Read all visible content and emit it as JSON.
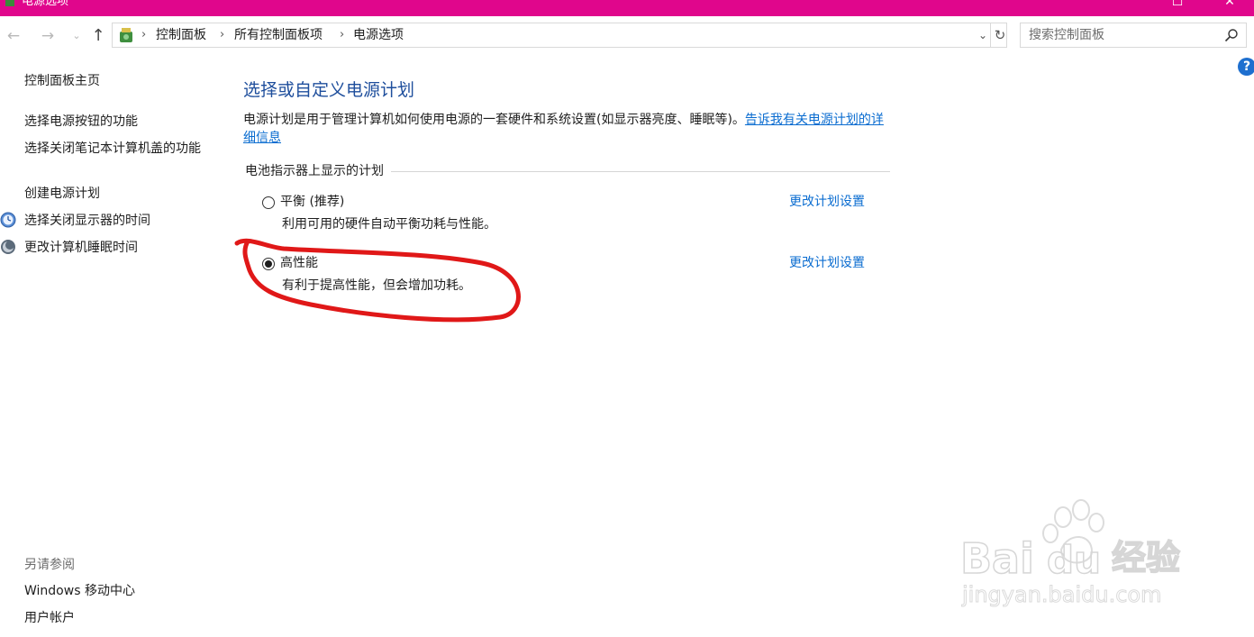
{
  "window": {
    "title": "电源选项",
    "maximize_glyph": "☐",
    "close_glyph": "✕"
  },
  "nav": {
    "back_glyph": "←",
    "forward_glyph": "→",
    "recent_glyph": "⌄",
    "up_glyph": "↑"
  },
  "breadcrumb": {
    "items": [
      "控制面板",
      "所有控制面板项",
      "电源选项"
    ],
    "separator": "›",
    "dropdown_glyph": "⌄",
    "refresh_glyph": "↻"
  },
  "search": {
    "placeholder": "搜索控制面板"
  },
  "help": {
    "glyph": "?"
  },
  "sidebar": {
    "home": "控制面板主页",
    "links": [
      "选择电源按钮的功能",
      "选择关闭笔记本计算机盖的功能",
      "创建电源计划",
      "选择关闭显示器的时间",
      "更改计算机睡眠时间"
    ],
    "see_also_label": "另请参阅",
    "see_also": [
      "Windows 移动中心",
      "用户帐户"
    ]
  },
  "main": {
    "title": "选择或自定义电源计划",
    "description": "电源计划是用于管理计算机如何使用电源的一套硬件和系统设置(如显示器亮度、睡眠等)。",
    "description_link": "告诉我有关电源计划的详细信息",
    "group_label": "电池指示器上显示的计划",
    "plans": [
      {
        "name": "平衡 (推荐)",
        "description": "利用可用的硬件自动平衡功耗与性能。",
        "link": "更改计划设置",
        "selected": false
      },
      {
        "name": "高性能",
        "description": "有利于提高性能，但会增加功耗。",
        "link": "更改计划设置",
        "selected": true
      }
    ]
  },
  "colors": {
    "title_bar": "#e0068c",
    "link": "#0a6cd0",
    "heading": "#1e4e9c",
    "annotation": "#e01818"
  },
  "watermark": {
    "brand": "Bai du 经验",
    "url": "jingyan.baidu.com"
  }
}
